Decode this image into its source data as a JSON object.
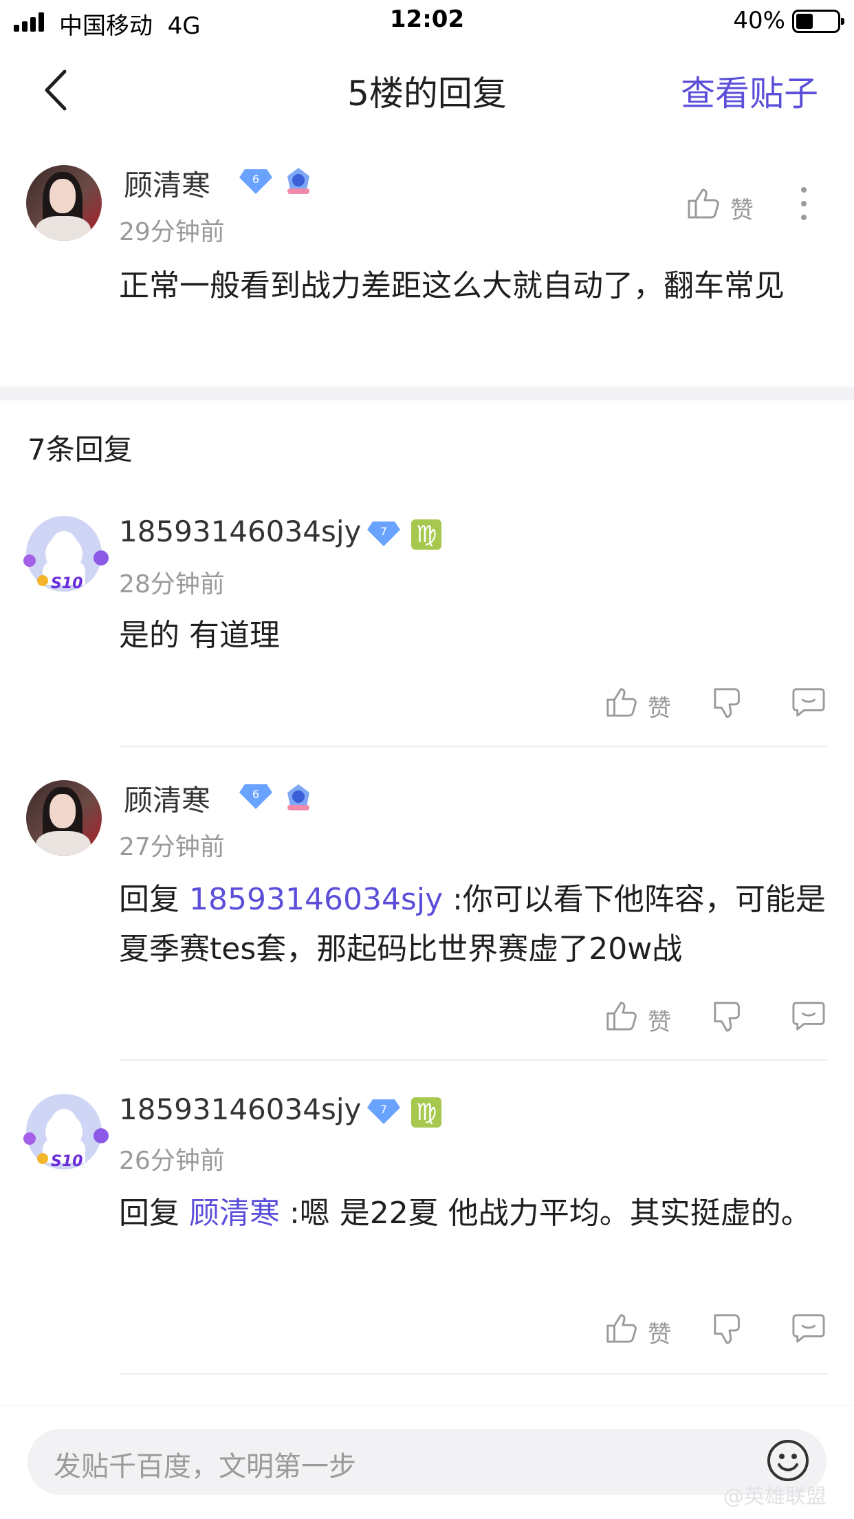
{
  "status_bar": {
    "carrier": "中国移动",
    "network": "4G",
    "time": "12:02",
    "battery": "40%"
  },
  "nav": {
    "title": "5楼的回复",
    "action": "查看贴子"
  },
  "main_comment": {
    "username": "顾清寒",
    "level": "6",
    "time": "29分钟前",
    "like_label": "赞",
    "content": "正常一般看到战力差距这么大就自动了，翻车常见"
  },
  "replies_header": "7条回复",
  "replies": [
    {
      "username": "18593146034sjy",
      "level": "7",
      "zodiac": "♍",
      "avatar_badge": "S10",
      "time": "28分钟前",
      "reply_prefix": "",
      "mention": "",
      "content": "是的 有道理",
      "like_label": "赞"
    },
    {
      "username": "顾清寒",
      "level": "6",
      "time": "27分钟前",
      "reply_prefix": "回复 ",
      "mention": "18593146034sjy",
      "content": " :你可以看下他阵容，可能是夏季赛tes套，那起码比世界赛虚了20w战",
      "like_label": "赞"
    },
    {
      "username": "18593146034sjy",
      "level": "7",
      "zodiac": "♍",
      "avatar_badge": "S10",
      "time": "26分钟前",
      "reply_prefix": "回复 ",
      "mention": "顾清寒",
      "content": " :嗯 是22夏 他战力平均。其实挺虚的。",
      "like_label": "赞"
    }
  ],
  "compose": {
    "placeholder": "发贴千百度，文明第一步"
  },
  "watermark": "@英雄联盟",
  "colors": {
    "accent": "#5b4fd9",
    "muted": "#9a9a9a",
    "badge_blue": "#6aa3ff",
    "zodiac_green": "#a6c84e"
  }
}
